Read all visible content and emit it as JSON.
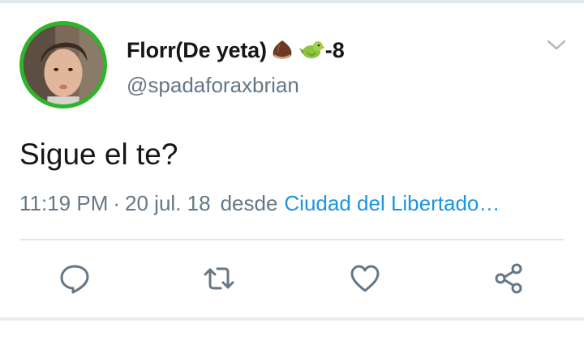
{
  "tweet": {
    "author": {
      "display_name": "Florr(De yeta)",
      "emojis": [
        "chestnut-icon",
        "bird-icon"
      ],
      "name_suffix": "-8",
      "handle": "@spadaforaxbrian",
      "avatar_ring_color": "#2fb52b"
    },
    "text": "Sigue el te?",
    "meta": {
      "time": "11:19 PM",
      "separator": "·",
      "date": "20 jul. 18",
      "desde": "desde",
      "place": "Ciudad del Libertado…"
    },
    "actions": [
      "reply-icon",
      "retweet-icon",
      "like-icon",
      "share-icon"
    ]
  },
  "colors": {
    "text_primary": "#14171a",
    "text_secondary": "#657786",
    "link": "#1b95e0",
    "icon": "#657786"
  }
}
